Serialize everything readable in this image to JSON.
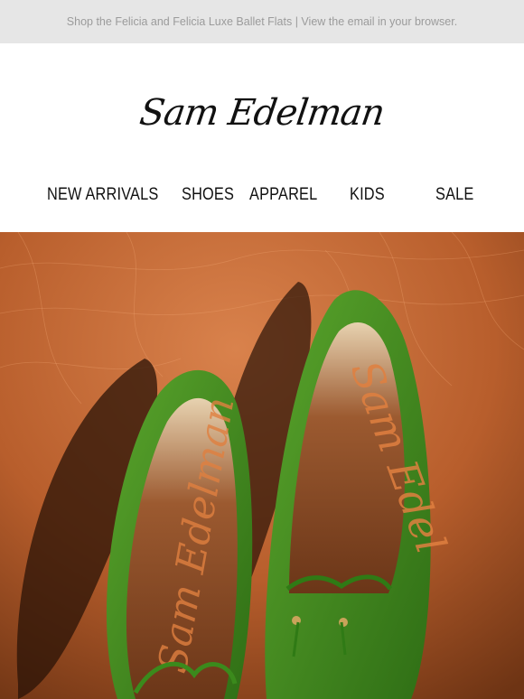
{
  "preheader": {
    "text": "Shop the Felicia and Felicia Luxe Ballet Flats | View the email in your browser."
  },
  "brand": {
    "logo_text": "Sam Edelman"
  },
  "nav": {
    "items": [
      {
        "label": "NEW ARRIVALS"
      },
      {
        "label": "SHOES"
      },
      {
        "label": "APPAREL"
      },
      {
        "label": "KIDS"
      },
      {
        "label": "SALE"
      }
    ]
  },
  "hero": {
    "image_subject": "green ballet flats with bow on orange textured background",
    "colors": {
      "background": "#c8652f",
      "shoe_green": "#3f8a1f",
      "insole": "#b26a3a"
    }
  }
}
